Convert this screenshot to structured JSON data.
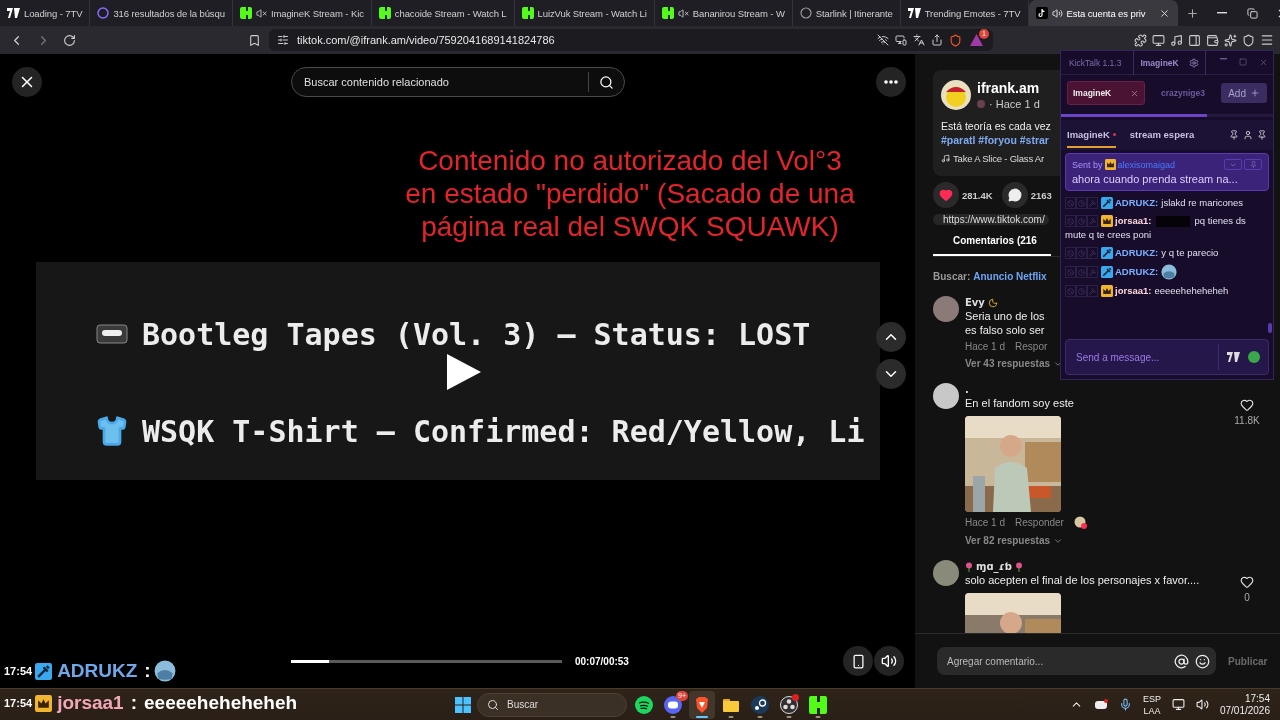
{
  "browser": {
    "tabs": [
      {
        "kind": "seventv",
        "title": "Loading - 7TV",
        "muted": false,
        "playing": false,
        "selected": false
      },
      {
        "kind": "site",
        "title": "316 resultados de la búsqu",
        "muted": false,
        "playing": false,
        "selected": false
      },
      {
        "kind": "kick",
        "title": "ImagineK Stream - Kic",
        "muted": true,
        "playing": false,
        "selected": false
      },
      {
        "kind": "kick",
        "title": "chacoide Stream - Watch L",
        "muted": false,
        "playing": false,
        "selected": false
      },
      {
        "kind": "kick",
        "title": "LuizVuk Stream - Watch Li",
        "muted": false,
        "playing": false,
        "selected": false
      },
      {
        "kind": "kick",
        "title": "Bananirou Stream - W",
        "muted": true,
        "playing": false,
        "selected": false
      },
      {
        "kind": "starlink",
        "title": "Starlink | Itinerante",
        "muted": false,
        "playing": false,
        "selected": false
      },
      {
        "kind": "seventv",
        "title": "Trending Emotes - 7TV",
        "muted": false,
        "playing": false,
        "selected": false
      },
      {
        "kind": "tiktok",
        "title": "Esta cuenta es priv",
        "muted": false,
        "playing": true,
        "selected": true
      }
    ],
    "url": "tiktok.com/@ifrank.am/video/7592041689141824786",
    "alert_badge": "1"
  },
  "video": {
    "search_placeholder": "Buscar contenido relacionado",
    "caption_lines": [
      "Contenido no autorizado del Vol°3",
      "en estado \"perdido\" (Sacado de una",
      "página real del SWQK SQUAWK)"
    ],
    "rows": [
      {
        "kind": "tape",
        "text": "Bootleg Tapes (Vol. 3) — Status: LOST"
      },
      {
        "kind": "shirt",
        "text": "WSQK T-Shirt — Confirmed: Red/Yellow, Li"
      }
    ],
    "progress": {
      "level": 0.14
    },
    "time": "00:07/00:53"
  },
  "post": {
    "author": "ifrank.am",
    "posted": "· Hace 1 d",
    "description": "Está teoría es cada vez",
    "hashtags": "#paratl #foryou #strar",
    "music": "Take A Slice - Glass Ar",
    "likes": "281.4K",
    "comments": "2163",
    "link": "https://www.tiktok.com/",
    "comments_tab": "Comentarios (216",
    "search_label": "Buscar:",
    "search_term": "Anuncio Netflix"
  },
  "comments": [
    {
      "kind": "moon",
      "user": "Evy",
      "text_lines": [
        "Seria uno de los",
        "es falso solo ser"
      ],
      "has_picture": false,
      "date": "Hace 1 d",
      "reply": "Respor",
      "creator_liked": false,
      "replies": "Ver 43 respuestas"
    },
    {
      "kind": "plain",
      "user": ".",
      "text_lines": [
        "En el fandom soy este"
      ],
      "has_picture": true,
      "likes": "11.8K",
      "date": "Hace 1 d",
      "reply": "Responder",
      "creator_liked": true,
      "replies": "Ver 82 respuestas"
    },
    {
      "kind": "flowers",
      "user": "ɱɑ_ɾƅ",
      "text_lines": [
        "solo acepten el final de los personajes x favor...."
      ],
      "has_picture": true,
      "likes": "0"
    }
  ],
  "comment_box": {
    "placeholder": "Agregar comentario...",
    "submit": "Publicar"
  },
  "kicktalk": {
    "title": "KickTalk 1.1.3",
    "account": "ImagineK",
    "chatrooms": [
      {
        "name": "ImagineK",
        "selected": true
      },
      {
        "name": "crazynige3",
        "selected": false
      }
    ],
    "add_button": "Add",
    "sync_bar": {
      "level": 0.69
    },
    "channels": [
      {
        "name": "ImagineK",
        "live": true,
        "selected": true
      },
      {
        "name": "stream espera",
        "live": false,
        "selected": false
      }
    ],
    "pinned": {
      "label": "Sent by",
      "moderator": false,
      "vip": true,
      "user": "alexisomaigad",
      "text": "ahora cuando prenda stream na..."
    },
    "messages": [
      {
        "moderator": true,
        "vip": false,
        "user": "ADRUKZ:",
        "kind": "text",
        "text": "jslakd re maricones",
        "redacted": false
      },
      {
        "moderator": false,
        "vip": true,
        "user": "jorsaa1:",
        "kind": "text",
        "text": "pq tienes ds",
        "continuation": "mute q te crees poni",
        "redacted": true
      },
      {
        "moderator": true,
        "vip": false,
        "user": "ADRUKZ:",
        "kind": "text",
        "text": "y q te parecio",
        "redacted": false
      },
      {
        "moderator": true,
        "vip": false,
        "user": "ADRUKZ:",
        "kind": "emote",
        "redacted": false
      },
      {
        "moderator": false,
        "vip": true,
        "user": "jorsaa1:",
        "kind": "text",
        "text": "eeeeeheheheheh",
        "redacted": false
      }
    ],
    "input_placeholder": "Send a message..."
  },
  "stream_overlay": [
    {
      "time": "17:54",
      "moderator": true,
      "vip": false,
      "user": "ADRUKZ",
      "sep": ":",
      "kind": "emote"
    },
    {
      "time": "17:54",
      "moderator": false,
      "vip": true,
      "user": "jorsaa1",
      "sep": ":",
      "kind": "text",
      "text": "eeeeeheheheheh"
    }
  ],
  "taskbar": {
    "search_placeholder": "Buscar",
    "apps": [
      {
        "kind": "spotify",
        "running": false,
        "active": false,
        "alert": false
      },
      {
        "kind": "discord",
        "running": true,
        "active": false,
        "alert": false,
        "badge": "9+"
      },
      {
        "kind": "brave",
        "running": true,
        "active": true,
        "alert": false
      },
      {
        "kind": "files",
        "running": true,
        "active": false,
        "alert": false
      },
      {
        "kind": "steam",
        "running": true,
        "active": false,
        "alert": false
      },
      {
        "kind": "obs",
        "running": true,
        "active": false,
        "alert": true
      },
      {
        "kind": "kick",
        "running": true,
        "active": false,
        "alert": false
      }
    ],
    "language": [
      "ESP",
      "LAA"
    ],
    "time": "17:54",
    "date": "07/01/2026"
  }
}
